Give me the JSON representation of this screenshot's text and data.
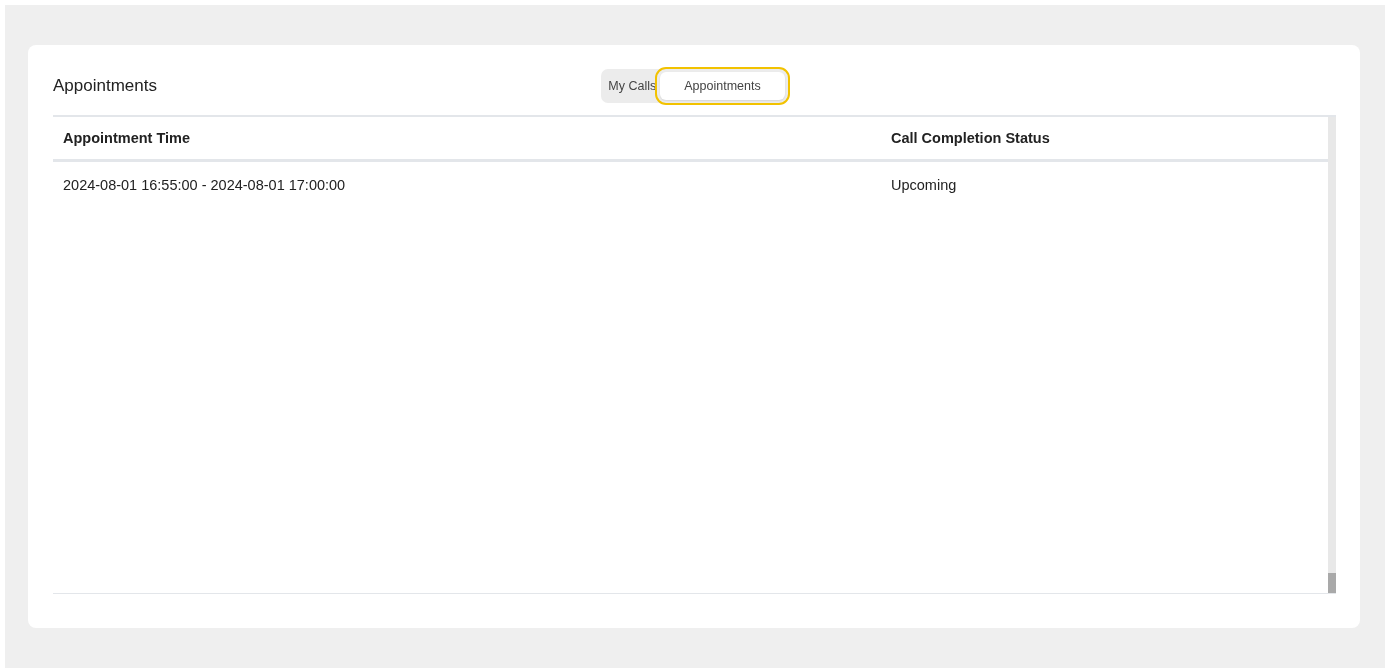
{
  "title": "Appointments",
  "tabs": [
    {
      "label": "My Calls",
      "selected": false
    },
    {
      "label": "Appointments",
      "selected": true
    }
  ],
  "table": {
    "columns": [
      "Appointment Time",
      "Call Completion Status"
    ],
    "rows": [
      [
        "2024-08-01 16:55:00 - 2024-08-01 17:00:00",
        "Upcoming"
      ]
    ]
  }
}
